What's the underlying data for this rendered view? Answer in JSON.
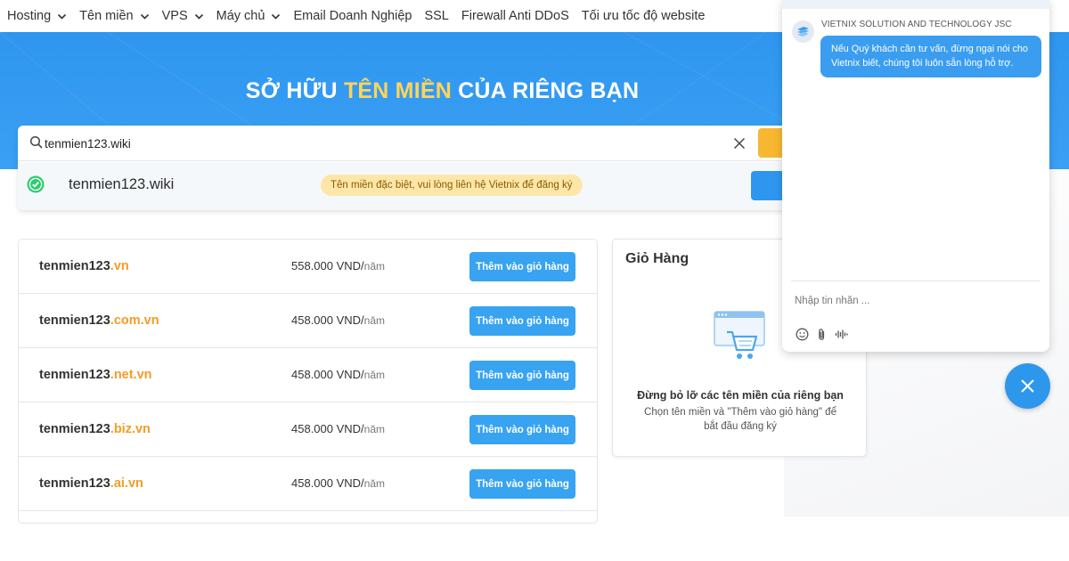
{
  "nav": {
    "items": [
      {
        "label": "Hosting",
        "has_dropdown": true
      },
      {
        "label": "Tên miền",
        "has_dropdown": true
      },
      {
        "label": "VPS",
        "has_dropdown": true
      },
      {
        "label": "Máy chủ",
        "has_dropdown": true
      },
      {
        "label": "Email Doanh Nghiệp",
        "has_dropdown": false
      },
      {
        "label": "SSL",
        "has_dropdown": false
      },
      {
        "label": "Firewall Anti DDoS",
        "has_dropdown": false
      },
      {
        "label": "Tối ưu tốc độ website",
        "has_dropdown": false
      }
    ]
  },
  "hero": {
    "title_part1": "SỞ HỮU ",
    "title_highlight": "TÊN MIỀN",
    "title_part2": " CỦA RIÊNG BẠN",
    "highlight_color": "#ffd45a"
  },
  "search": {
    "value": "tenmien123.wiki",
    "search_icon": "search-icon",
    "clear_icon": "close-icon"
  },
  "result": {
    "status_icon": "check-circle-icon",
    "domain": "tenmien123.wiki",
    "badge": "Tên miền đặc biệt, vui lòng liên hệ Vietnix để đăng ký"
  },
  "domains": [
    {
      "base": "tenmien123",
      "tld": ".vn",
      "price": "558.000 VND/",
      "unit": "năm",
      "button": "Thêm vào giỏ hàng"
    },
    {
      "base": "tenmien123",
      "tld": ".com.vn",
      "price": "458.000 VND/",
      "unit": "năm",
      "button": "Thêm vào giỏ hàng"
    },
    {
      "base": "tenmien123",
      "tld": ".net.vn",
      "price": "458.000 VND/",
      "unit": "năm",
      "button": "Thêm vào giỏ hàng"
    },
    {
      "base": "tenmien123",
      "tld": ".biz.vn",
      "price": "458.000 VND/",
      "unit": "năm",
      "button": "Thêm vào giỏ hàng"
    },
    {
      "base": "tenmien123",
      "tld": ".ai.vn",
      "price": "458.000 VND/",
      "unit": "năm",
      "button": "Thêm vào giỏ hàng"
    }
  ],
  "cart": {
    "title": "Giỏ Hàng",
    "icon": "shopping-cart-icon",
    "empty_heading": "Đừng bỏ lỡ các tên miền của riêng bạn",
    "empty_text": "Chọn tên miền và \"Thêm vào giỏ hàng\" để bắt đầu đăng ký"
  },
  "chat": {
    "agent_name": "VIETNIX SOLUTION AND TECHNOLOGY JSC",
    "message": "Nếu Quý khách cần tư vấn, đừng ngại nói cho Vietnix biết, chúng tôi luôn sẵn lòng hỗ trợ.",
    "input_placeholder": "Nhập tin nhắn ...",
    "tools": [
      "emoji-icon",
      "attachment-icon",
      "voice-icon"
    ],
    "close_icon": "close-icon"
  },
  "colors": {
    "primary": "#2f96ef",
    "accent": "#f39c26",
    "button": "#37a3f1",
    "search_button": "#f7b731",
    "success": "#2ecc71"
  }
}
